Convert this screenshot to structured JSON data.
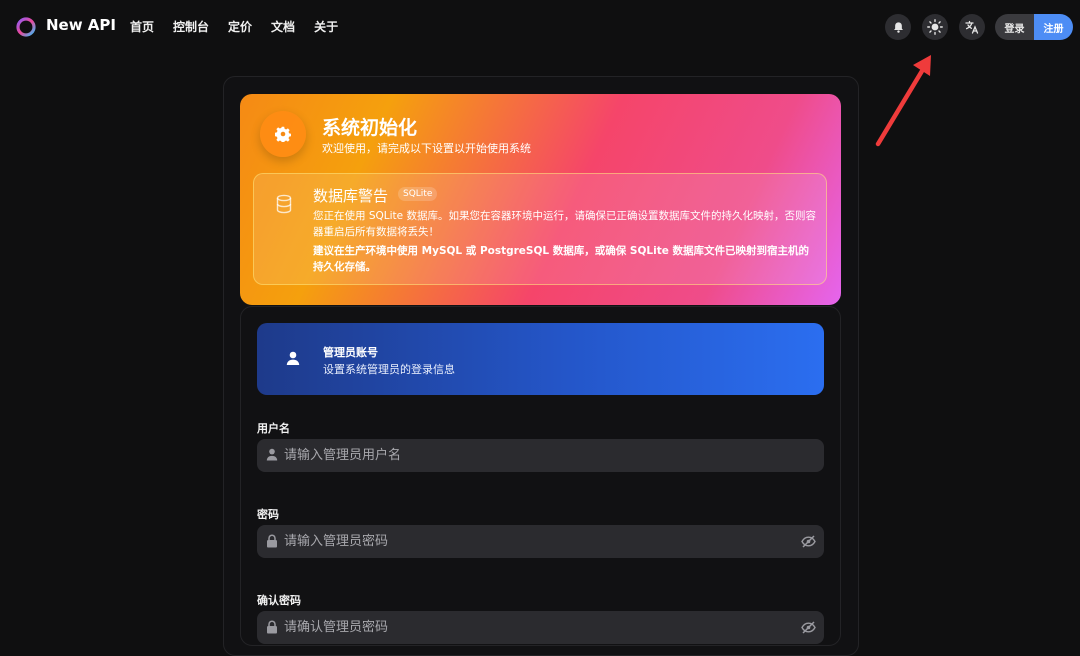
{
  "header": {
    "app_title": "New API",
    "nav": [
      "首页",
      "控制台",
      "定价",
      "文档",
      "关于"
    ],
    "icons": [
      "bell-icon",
      "sun-icon",
      "translate-icon"
    ],
    "login_label": "登录",
    "register_label": "注册",
    "accent": "#4d8df5"
  },
  "hero": {
    "title": "系统初始化",
    "subtitle": "欢迎使用，请完成以下设置以开始使用系统",
    "warning": {
      "title": "数据库警告",
      "tag": "SQLite",
      "text": "您正在使用 SQLite 数据库。如果您在容器环境中运行，请确保已正确设置数据库文件的持久化映射，否则容器重启后所有数据将丢失！",
      "strong": "建议在生产环境中使用 MySQL 或 PostgreSQL 数据库，或确保 SQLite 数据库文件已映射到宿主机的持久化存储。"
    }
  },
  "admin": {
    "title": "管理员账号",
    "subtitle": "设置系统管理员的登录信息"
  },
  "form": {
    "username_label": "用户名",
    "username_placeholder": "请输入管理员用户名",
    "password_label": "密码",
    "password_placeholder": "请输入管理员密码",
    "confirm_label": "确认密码",
    "confirm_placeholder": "请确认管理员密码"
  }
}
